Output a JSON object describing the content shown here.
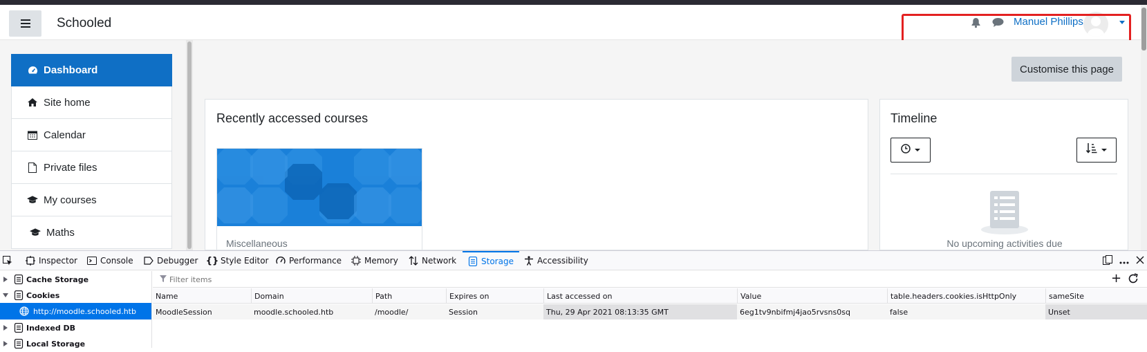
{
  "navbar": {
    "brand": "Schooled",
    "user_name": "Manuel Phillips"
  },
  "drawer": {
    "items": [
      {
        "label": "Dashboard",
        "icon": "dashboard-icon",
        "active": true
      },
      {
        "label": "Site home",
        "icon": "home-icon"
      },
      {
        "label": "Calendar",
        "icon": "calendar-icon"
      },
      {
        "label": "Private files",
        "icon": "file-icon"
      },
      {
        "label": "My courses",
        "icon": "graduation-cap-icon"
      },
      {
        "label": "Maths",
        "icon": "graduation-cap-icon"
      }
    ]
  },
  "main": {
    "customise_button": "Customise this page",
    "recent": {
      "title": "Recently accessed courses",
      "course_category": "Miscellaneous"
    },
    "timeline": {
      "title": "Timeline",
      "empty_text": "No upcoming activities due"
    }
  },
  "devtools": {
    "tabs": [
      {
        "label": "Inspector",
        "icon": "inspector-icon"
      },
      {
        "label": "Console",
        "icon": "console-icon"
      },
      {
        "label": "Debugger",
        "icon": "debugger-icon"
      },
      {
        "label": "Style Editor",
        "icon": "braces-icon"
      },
      {
        "label": "Performance",
        "icon": "gauge-icon"
      },
      {
        "label": "Memory",
        "icon": "chip-icon"
      },
      {
        "label": "Network",
        "icon": "arrows-updown-icon"
      },
      {
        "label": "Storage",
        "icon": "storage-icon",
        "selected": true
      },
      {
        "label": "Accessibility",
        "icon": "accessibility-icon"
      }
    ],
    "tree": [
      {
        "label": "Cache Storage",
        "expanded": false
      },
      {
        "label": "Cookies",
        "expanded": true
      },
      {
        "label": "http://moodle.schooled.htb",
        "selected": true
      },
      {
        "label": "Indexed DB",
        "expanded": false
      },
      {
        "label": "Local Storage",
        "expanded": false
      }
    ],
    "filter_placeholder": "Filter items",
    "table": {
      "headers": [
        "Name",
        "Domain",
        "Path",
        "Expires on",
        "Last accessed on",
        "Value",
        "table.headers.cookies.isHttpOnly",
        "sameSite"
      ],
      "rows": [
        [
          "MoodleSession",
          "moodle.schooled.htb",
          "/moodle/",
          "Session",
          "Thu, 29 Apr 2021 08:13:35 GMT",
          "6eg1tv9nbifmj4jao5rvsns0sq",
          "false",
          "Unset"
        ]
      ]
    }
  },
  "colors": {
    "accent": "#0f6fc5",
    "devtools_accent": "#0074e8",
    "highlight_box": "#e32020"
  }
}
